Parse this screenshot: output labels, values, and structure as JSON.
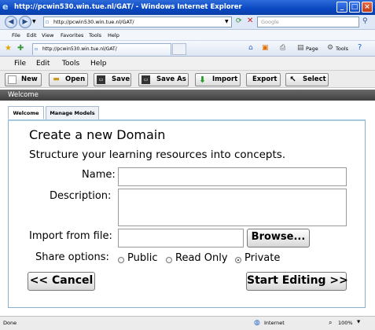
{
  "window": {
    "title": "http://pcwin530.win.tue.nl/GAT/ - Windows Internet Explorer"
  },
  "address": {
    "url": "http://pcwin530.win.tue.nl/GAT/",
    "search_placeholder": "Google"
  },
  "ie_menu": [
    "File",
    "Edit",
    "View",
    "Favorites",
    "Tools",
    "Help"
  ],
  "tab": {
    "label": "http://pcwin530.win.tue.nl/GAT/"
  },
  "ie_commands": {
    "page": "Page",
    "tools": "Tools"
  },
  "app_menu": [
    "File",
    "Edit",
    "Tools",
    "Help"
  ],
  "toolbar": {
    "new": "New",
    "open": "Open",
    "save": "Save",
    "save_as": "Save As",
    "import": "Import",
    "export": "Export",
    "select": "Select"
  },
  "welcome_bar": "Welcome",
  "tabs": {
    "welcome": "Welcome",
    "manage": "Manage Models"
  },
  "form": {
    "heading": "Create a new Domain",
    "subheading": "Structure your learning resources into concepts.",
    "name_label": "Name:",
    "description_label": "Description:",
    "import_label": "Import from file:",
    "browse": "Browse...",
    "share_label": "Share options:",
    "share_options": [
      "Public",
      "Read Only",
      "Private"
    ],
    "share_selected": "Private",
    "cancel": "<< Cancel",
    "start": "Start Editing >>"
  },
  "status": {
    "left": "Done",
    "zone": "Internet",
    "zoom": "100%"
  },
  "colors": {
    "titlebar": "#0a48c2",
    "welcome_bar": "#4a4a4a",
    "panel_border": "#8ab0d0"
  }
}
